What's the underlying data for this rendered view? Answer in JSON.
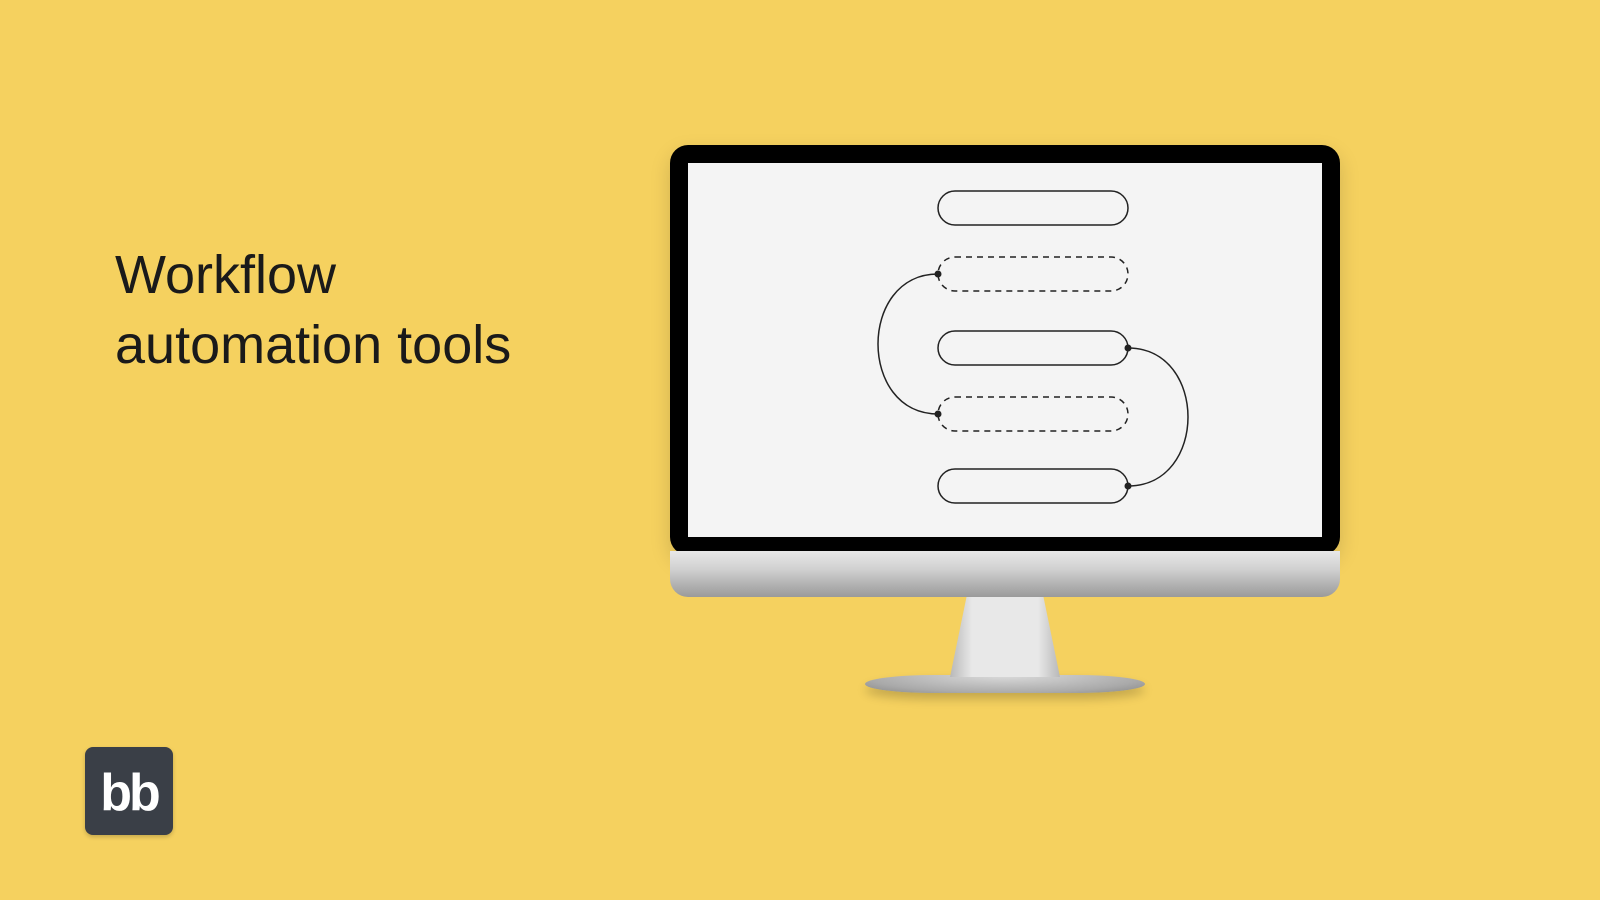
{
  "title": "Workflow\nautomation tools",
  "logo": {
    "text": "bb"
  }
}
